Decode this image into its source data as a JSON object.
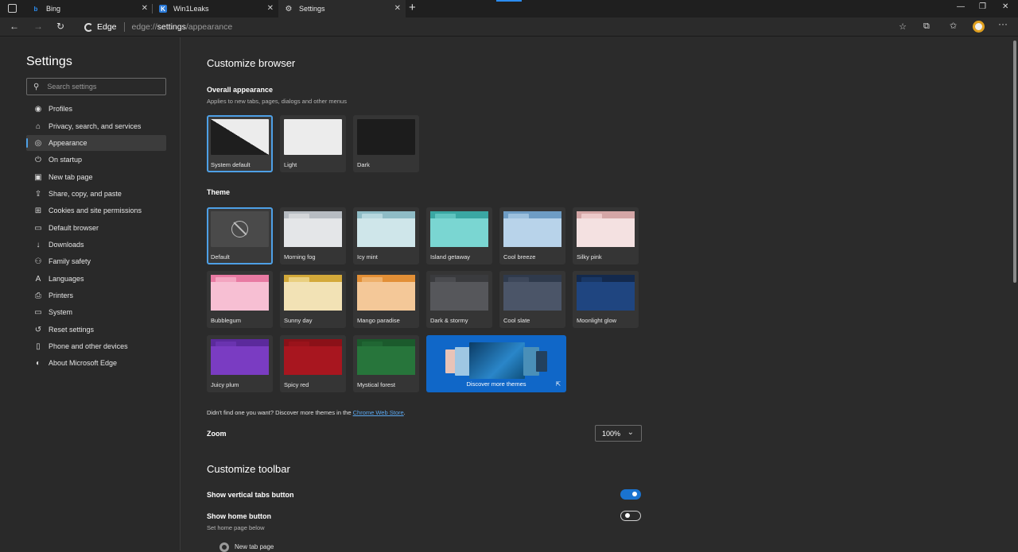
{
  "tabs": [
    {
      "title": "Bing",
      "icon": "bing-icon"
    },
    {
      "title": "Win1Leaks",
      "icon": "vk-icon"
    },
    {
      "title": "Settings",
      "icon": "gear-icon",
      "active": true
    }
  ],
  "address": {
    "brand": "Edge",
    "url_prefix": "edge://",
    "url_bold": "settings",
    "url_suffix": "/appearance"
  },
  "sidebar": {
    "title": "Settings",
    "search_placeholder": "Search settings",
    "items": [
      {
        "label": "Profiles",
        "icon": "person-icon"
      },
      {
        "label": "Privacy, search, and services",
        "icon": "lock-icon"
      },
      {
        "label": "Appearance",
        "icon": "palette-icon",
        "selected": true
      },
      {
        "label": "On startup",
        "icon": "power-icon"
      },
      {
        "label": "New tab page",
        "icon": "newtab-icon"
      },
      {
        "label": "Share, copy, and paste",
        "icon": "share-icon"
      },
      {
        "label": "Cookies and site permissions",
        "icon": "cookie-icon"
      },
      {
        "label": "Default browser",
        "icon": "browser-icon"
      },
      {
        "label": "Downloads",
        "icon": "download-icon"
      },
      {
        "label": "Family safety",
        "icon": "family-icon"
      },
      {
        "label": "Languages",
        "icon": "language-icon"
      },
      {
        "label": "Printers",
        "icon": "printer-icon"
      },
      {
        "label": "System",
        "icon": "system-icon"
      },
      {
        "label": "Reset settings",
        "icon": "reset-icon"
      },
      {
        "label": "Phone and other devices",
        "icon": "phone-icon"
      },
      {
        "label": "About Microsoft Edge",
        "icon": "edge-icon"
      }
    ]
  },
  "customize": {
    "title": "Customize browser",
    "overall_title": "Overall appearance",
    "overall_sub": "Applies to new tabs, pages, dialogs and other menus",
    "appearance_options": [
      {
        "label": "System default",
        "selected": true
      },
      {
        "label": "Light"
      },
      {
        "label": "Dark"
      }
    ],
    "theme_title": "Theme",
    "themes": [
      {
        "label": "Default",
        "selected": true
      },
      {
        "label": "Morning fog",
        "colors": [
          "#b7bcc2",
          "#e4e6e8",
          "#d3d6d9"
        ]
      },
      {
        "label": "Icy mint",
        "colors": [
          "#8fbcc6",
          "#cfe6ea",
          "#b6d7de"
        ]
      },
      {
        "label": "Island getaway",
        "colors": [
          "#3aa7a3",
          "#7ad6d2",
          "#5fc3bf"
        ]
      },
      {
        "label": "Cool breeze",
        "colors": [
          "#6e9cc4",
          "#b8d3ea",
          "#9cc0de"
        ]
      },
      {
        "label": "Silky pink",
        "colors": [
          "#d4a6a6",
          "#f4e1e1",
          "#ecc9c9"
        ]
      },
      {
        "label": "Bubblegum",
        "colors": [
          "#e87aa2",
          "#f7bfd3",
          "#f3a5c0"
        ]
      },
      {
        "label": "Sunny day",
        "colors": [
          "#d3a93a",
          "#f2e2b5",
          "#e9cf7f"
        ]
      },
      {
        "label": "Mango paradise",
        "colors": [
          "#e28f36",
          "#f4c898",
          "#eeb06a"
        ]
      },
      {
        "label": "Dark & stormy",
        "colors": [
          "#3a3b3e",
          "#56575b",
          "#4a4b4f"
        ]
      },
      {
        "label": "Cool slate",
        "colors": [
          "#2f3a4c",
          "#4b5568",
          "#3d475a"
        ]
      },
      {
        "label": "Moonlight glow",
        "colors": [
          "#13294d",
          "#1f4580",
          "#193765"
        ]
      },
      {
        "label": "Juicy plum",
        "colors": [
          "#5b2a9c",
          "#7a3cc2",
          "#6a33b0"
        ]
      },
      {
        "label": "Spicy red",
        "colors": [
          "#8b1118",
          "#a8161f",
          "#9a131b"
        ]
      },
      {
        "label": "Mystical forest",
        "colors": [
          "#1b5a2c",
          "#27753b",
          "#206633"
        ]
      }
    ],
    "discover_label": "Discover more themes",
    "store_note_prefix": "Didn't find one you want? Discover more themes in the ",
    "store_link": "Chrome Web Store",
    "store_note_suffix": ".",
    "zoom_label": "Zoom",
    "zoom_value": "100%"
  },
  "toolbar_section": {
    "title": "Customize toolbar",
    "vertical_tabs_label": "Show vertical tabs button",
    "vertical_tabs_on": true,
    "home_label": "Show home button",
    "home_on": false,
    "home_sub": "Set home page below",
    "radio_label": "New tab page"
  }
}
